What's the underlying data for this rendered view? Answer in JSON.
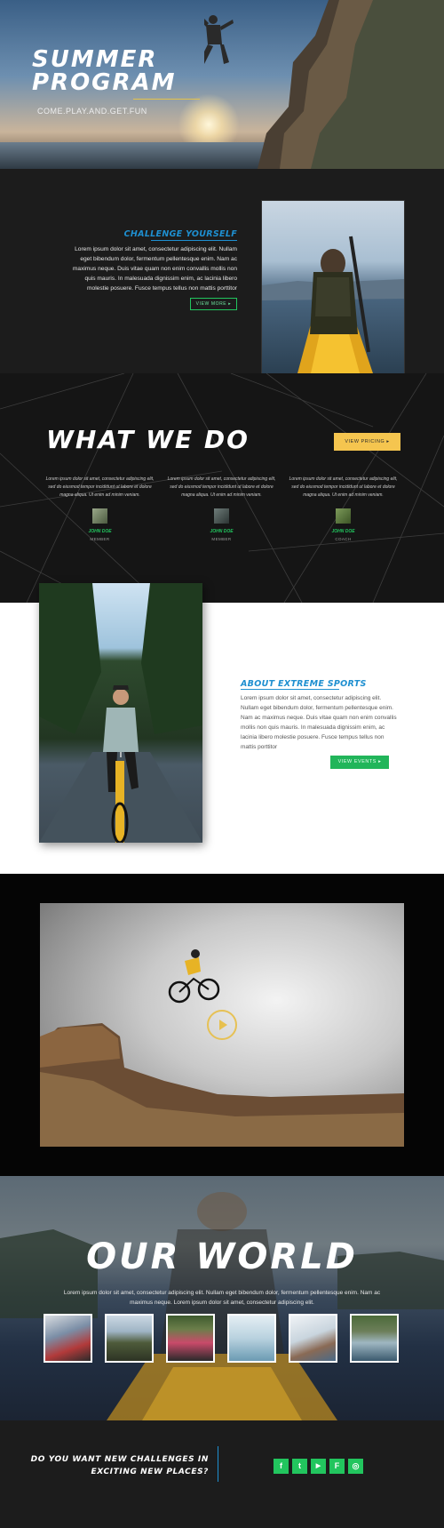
{
  "hero": {
    "title": "SUMMER PROGRAM",
    "subtitle": "COME.PLAY.AND.GET.FUN"
  },
  "challenge": {
    "title": "CHALLENGE YOURSELF",
    "text": "Lorem ipsum dolor sit amet, consectetur adipiscing elit. Nullam eget bibendum dolor, fermentum pellentesque enim. Nam ac maximus neque. Duis vitae quam non enim convallis mollis non quis mauris. In malesuada dignissim enim, ac lacinia libero molestie posuere. Fusce tempus tellus non mattis porttitor",
    "button": "VIEW MORE ▸"
  },
  "what_we_do": {
    "title": "WHAT WE DO",
    "button": "VIEW PRICING ▸",
    "members": [
      {
        "text": "Lorem ipsum dolor sit amet, consectetur adipiscing elit, sed do eiusmod tempor incididunt ut labore et dolore magna aliqua. Ut enim ad minim veniam.",
        "name": "JOHN DOE",
        "role": "MEMBER"
      },
      {
        "text": "Lorem ipsum dolor sit amet, consectetur adipiscing elit, sed do eiusmod tempor incididunt ut labore et dolore magna aliqua. Ut enim ad minim veniam.",
        "name": "JOHN DOE",
        "role": "MEMBER"
      },
      {
        "text": "Lorem ipsum dolor sit amet, consectetur adipiscing elit, sed do eiusmod tempor incididunt ut labore et dolore magna aliqua. Ut enim ad minim veniam.",
        "name": "JOHN DOE",
        "role": "COACH"
      }
    ]
  },
  "about": {
    "title": "ABOUT EXTREME SPORTS",
    "text": "Lorem ipsum dolor sit amet, consectetur adipiscing elit. Nullam eget bibendum dolor, fermentum pellentesque enim. Nam ac maximus neque. Duis vitae quam non enim convallis mollis non quis mauris. In malesuada dignissim enim, ac lacinia libero molestie posuere. Fusce tempus tellus non mattis porttitor",
    "button": "VIEW EVENTS ▸"
  },
  "video": {
    "play_icon": "play-icon"
  },
  "world": {
    "title": "OUR WORLD",
    "text": "Lorem ipsum dolor sit amet, consectetur adipiscing elit. Nullam eget bibendum dolor, fermentum pellentesque enim. Nam ac maximus neque. Lorem ipsum dolor sit amet, consectetur adipiscing elit."
  },
  "footer": {
    "question_line1": "DO YOU WANT NEW CHALLENGES IN",
    "question_line2": "EXCITING NEW PLACES?",
    "social": [
      {
        "icon": "facebook-icon",
        "glyph": "f"
      },
      {
        "icon": "twitter-icon",
        "glyph": "t"
      },
      {
        "icon": "youtube-icon",
        "glyph": "▶"
      },
      {
        "icon": "foursquare-icon",
        "glyph": "F"
      },
      {
        "icon": "instagram-icon",
        "glyph": "◎"
      }
    ]
  },
  "colors": {
    "accent_blue": "#1e8fd0",
    "accent_green": "#22c55e",
    "accent_yellow": "#f5c54f"
  }
}
